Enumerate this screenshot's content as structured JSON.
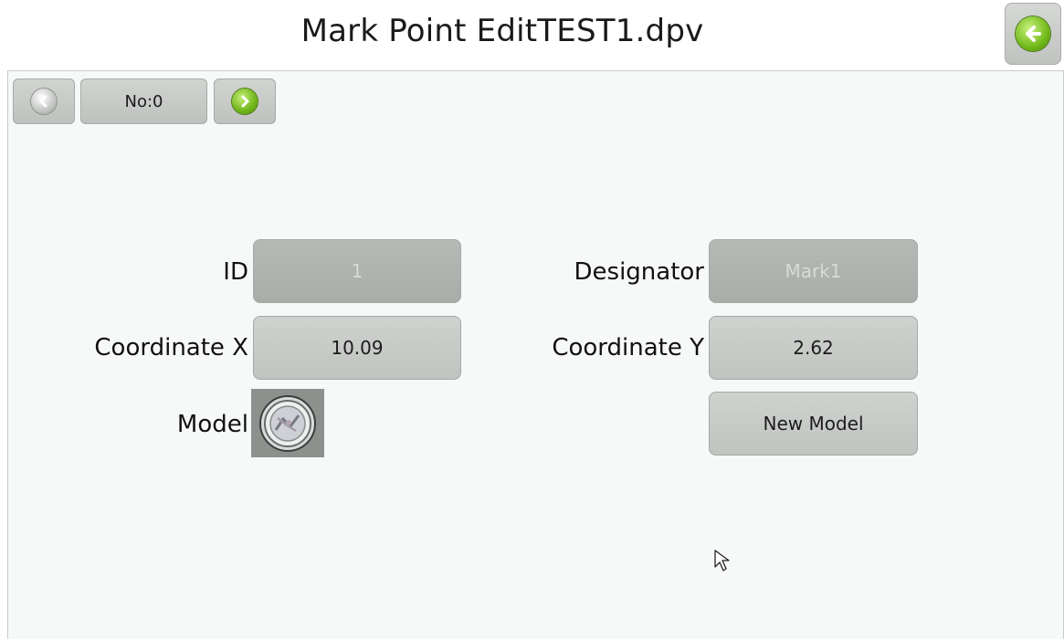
{
  "header": {
    "title": "Mark Point EditTEST1.dpv",
    "back_icon": "back-arrow-icon"
  },
  "nav": {
    "prev_icon": "chevron-left-icon",
    "index_label": "No:0",
    "next_icon": "chevron-right-icon"
  },
  "form": {
    "id_label": "ID",
    "id_value": "1",
    "designator_label": "Designator",
    "designator_value": "Mark1",
    "coord_x_label": "Coordinate X",
    "coord_x_value": "10.09",
    "coord_y_label": "Coordinate Y",
    "coord_y_value": "2.62",
    "model_label": "Model",
    "model_icon": "fiducial-mark-image",
    "new_model_label": "New Model"
  },
  "colors": {
    "accent_green": "#6fb518",
    "panel_bg": "#f6f9f7",
    "button_gray": "#c4c7c4"
  }
}
